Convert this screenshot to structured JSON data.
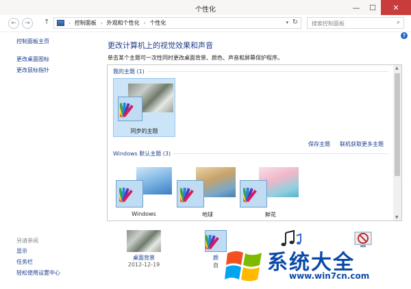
{
  "window": {
    "title": "个性化"
  },
  "titlebar": {
    "minimize": "—",
    "maximize": "☐",
    "close": "✕"
  },
  "nav": {
    "back": "←",
    "forward": "→",
    "up": "↑",
    "breadcrumb": [
      "控制面板",
      "外观和个性化",
      "个性化"
    ],
    "separator": "›",
    "dropdown": "▾",
    "refresh": "↻"
  },
  "search": {
    "placeholder": "搜索控制面板",
    "icon": "⌕"
  },
  "sidebar": {
    "home": "控制面板主页",
    "links": [
      "更改桌面图标",
      "更改鼠标指针"
    ]
  },
  "help": "?",
  "main": {
    "heading": "更改计算机上的视觉效果和声音",
    "subtext": "单击某个主题可一次性同时更改桌面背景、颜色、声音和屏幕保护程序。",
    "my_themes": {
      "title": "我的主题 (1)",
      "items": [
        {
          "label": "同步的主题"
        }
      ]
    },
    "actions": {
      "save": "保存主题",
      "online": "联机获取更多主题"
    },
    "default_themes": {
      "title": "Windows 默认主题 (3)",
      "items": [
        {
          "label": "Windows"
        },
        {
          "label": "地球"
        },
        {
          "label": "鲜花"
        }
      ]
    }
  },
  "see_also": {
    "title": "另请参阅",
    "links": [
      "显示",
      "任务栏",
      "轻松使用设置中心"
    ]
  },
  "bottom": {
    "desktop_bg": {
      "name": "桌面背景",
      "sub": "2012-12-19"
    },
    "color": {
      "name": "颜",
      "sub": "自"
    }
  },
  "watermark": {
    "text": "系统大全",
    "url": "www.win7cn.com"
  },
  "colors": {
    "link": "#1a3e8c",
    "heading": "#1e3c8a",
    "selected_bg": "#cce4f7",
    "close_button": "#c83c3c"
  },
  "icons": [
    "back-icon",
    "forward-icon",
    "up-arrow-icon",
    "control-panel-icon",
    "refresh-icon",
    "search-icon",
    "help-icon",
    "color-fan-icon",
    "sound-notes-icon",
    "screensaver-icon",
    "windows-logo-icon"
  ]
}
